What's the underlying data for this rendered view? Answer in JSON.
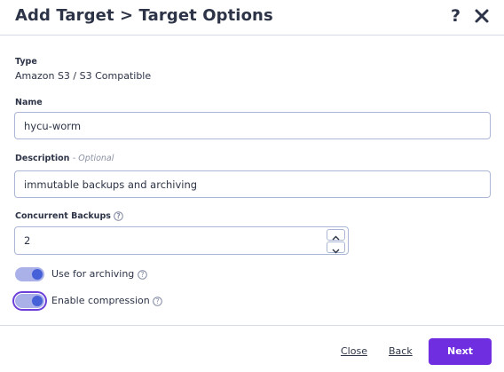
{
  "dialog": {
    "title": "Add Target > Target Options",
    "help_label": "?",
    "close_icon": "close-icon"
  },
  "form": {
    "type": {
      "label": "Type",
      "value": "Amazon S3 / S3 Compatible"
    },
    "name": {
      "label": "Name",
      "value": "hycu-worm"
    },
    "description": {
      "label": "Description",
      "optional_tag": "- Optional",
      "value": "immutable backups and archiving"
    },
    "concurrent_backups": {
      "label": "Concurrent Backups",
      "value": "2"
    },
    "use_for_archiving": {
      "label": "Use for archiving",
      "enabled": true
    },
    "enable_compression": {
      "label": "Enable compression",
      "enabled": true
    }
  },
  "footer": {
    "close_label": "Close",
    "back_label": "Back",
    "next_label": "Next"
  },
  "colors": {
    "accent": "#6f2fe0",
    "toggle_on": "#4660d8",
    "toggle_track": "#aab1e8",
    "border": "#aab6d6"
  }
}
